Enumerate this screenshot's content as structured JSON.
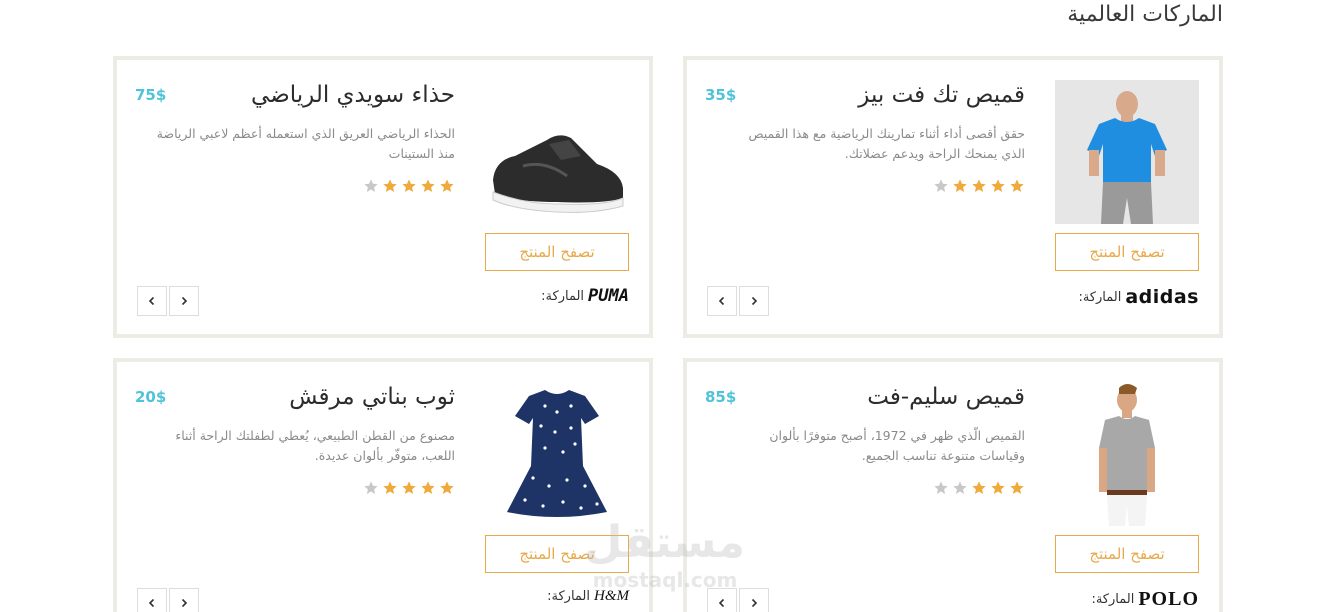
{
  "section_title": "الماركات العالمية",
  "browse_label": "تصفح المنتج",
  "brand_label": "الماركة:",
  "colors": {
    "accent": "#e8a94a",
    "price": "#4fc3d9",
    "star_on": "#f0a93b",
    "star_off": "#c8c8c8",
    "border": "#ecebe4"
  },
  "products": [
    {
      "title": "قميص تك فت بيز",
      "price": "35$",
      "description": "حقق أقصى أداء أثناء تمارينك الرياضية مع هذا القميص الذي يمنحك الراحة ويدعم عضلاتك.",
      "rating": 4,
      "rating_max": 5,
      "brand": "adidas",
      "image": "blue-tshirt-photo"
    },
    {
      "title": "حذاء سويدي الرياضي",
      "price": "75$",
      "description": "الحذاء الرياضي العريق الذي استعمله أعظم لاعبي الرياضة منذ الستينات",
      "rating": 4,
      "rating_max": 5,
      "brand": "PUMA",
      "image": "black-sneaker-photo"
    },
    {
      "title": "قميص سليم-فت",
      "price": "85$",
      "description": "القميص الّذي ظهر في 1972، أصبح متوفرًا بألوان وقياسات متنوعة تناسب الجميع.",
      "rating": 3,
      "rating_max": 5,
      "brand": "POLO",
      "image": "grey-polo-photo"
    },
    {
      "title": "ثوب بناتي مرقش",
      "price": "20$",
      "description": "مصنوع من القطن الطبيعي، يُعطي لطفلتك الراحة أثناء اللعب، متوفّر بألوان عديدة.",
      "rating": 4,
      "rating_max": 5,
      "brand": "H&M",
      "image": "navy-dress-photo"
    }
  ],
  "watermark": {
    "arabic": "مستقل",
    "latin": "mostaql.com"
  }
}
